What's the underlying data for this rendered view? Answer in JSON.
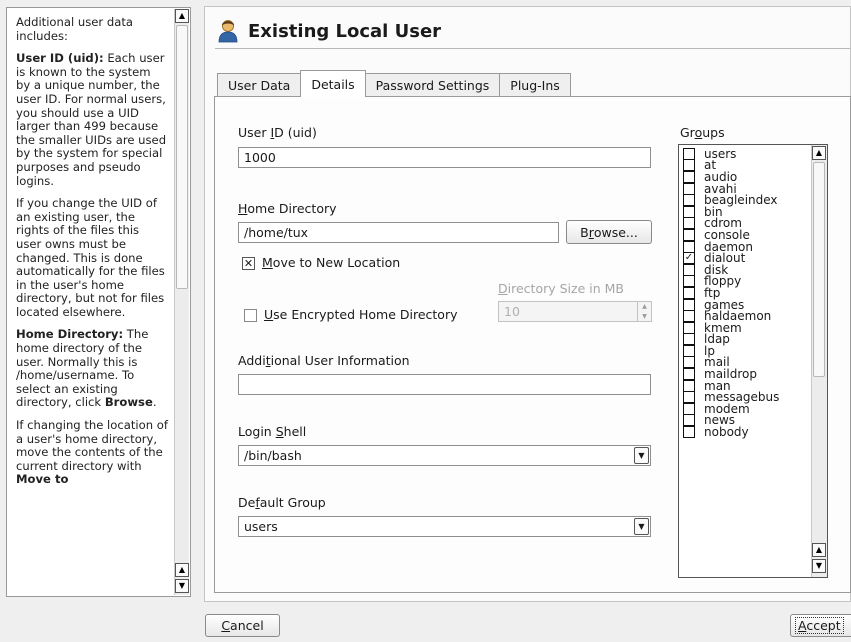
{
  "help": {
    "p1": "Additional user data includes:",
    "uid_head": "User ID (uid):",
    "uid_text": " Each user is known to the system by a unique number, the user ID. For normal users, you should use a UID larger than 499 because the smaller UIDs are used by the system for special purposes and pseudo logins.",
    "p3": "If you change the UID of an existing user, the rights of the files this user owns must be changed. This is done automatically for the files in the user's home directory, but not for files located elsewhere.",
    "home_head": "Home Directory:",
    "home_text_1": " The home directory of the user. Normally this is /home/username. To select an existing directory, click ",
    "home_bold_browse": "Browse",
    "home_text_2": ".",
    "p5_text": "If changing the location of a user's home directory, move the contents of the current directory with ",
    "p5_bold": "Move to"
  },
  "header": {
    "title": "Existing Local User",
    "icon": "user-icon"
  },
  "tabs": [
    "User Data",
    "Details",
    "Password Settings",
    "Plug-Ins"
  ],
  "active_tab": "Details",
  "form": {
    "uid_label_pre": "User ",
    "uid_label_u": "I",
    "uid_label_post": "D (uid)",
    "uid_value": "1000",
    "home_label_u": "H",
    "home_label_post": "ome Directory",
    "home_value": "/home/tux",
    "browse_pre": "B",
    "browse_u": "r",
    "browse_post": "owse...",
    "move_label_u": "M",
    "move_label_post": "ove to New Location",
    "move_checked": true,
    "dirsize_label_u": "D",
    "dirsize_label_post": "irectory Size in MB",
    "dirsize_value": "10",
    "encrypted_label_u": "U",
    "encrypted_label_post": "se Encrypted Home Directory",
    "encrypted_checked": false,
    "addinfo_label_pre": "Addi",
    "addinfo_label_u": "t",
    "addinfo_label_post": "ional User Information",
    "addinfo_value": "",
    "shell_label_pre": "Login ",
    "shell_label_u": "S",
    "shell_label_post": "hell",
    "shell_value": "/bin/bash",
    "group_label_pre": "De",
    "group_label_u": "f",
    "group_label_post": "ault Group",
    "group_value": "users"
  },
  "groups": {
    "label_pre": "Gr",
    "label_u": "o",
    "label_post": "ups",
    "items": [
      {
        "name": "users",
        "checked": false
      },
      {
        "name": "at",
        "checked": false
      },
      {
        "name": "audio",
        "checked": false
      },
      {
        "name": "avahi",
        "checked": false
      },
      {
        "name": "beagleindex",
        "checked": false
      },
      {
        "name": "bin",
        "checked": false
      },
      {
        "name": "cdrom",
        "checked": false
      },
      {
        "name": "console",
        "checked": false
      },
      {
        "name": "daemon",
        "checked": false
      },
      {
        "name": "dialout",
        "checked": true
      },
      {
        "name": "disk",
        "checked": false
      },
      {
        "name": "floppy",
        "checked": false
      },
      {
        "name": "ftp",
        "checked": false
      },
      {
        "name": "games",
        "checked": false
      },
      {
        "name": "haldaemon",
        "checked": false
      },
      {
        "name": "kmem",
        "checked": false
      },
      {
        "name": "ldap",
        "checked": false
      },
      {
        "name": "lp",
        "checked": false
      },
      {
        "name": "mail",
        "checked": false
      },
      {
        "name": "maildrop",
        "checked": false
      },
      {
        "name": "man",
        "checked": false
      },
      {
        "name": "messagebus",
        "checked": false
      },
      {
        "name": "modem",
        "checked": false
      },
      {
        "name": "news",
        "checked": false
      },
      {
        "name": "nobody",
        "checked": false
      }
    ]
  },
  "footer": {
    "cancel_u": "C",
    "cancel_post": "ancel",
    "accept_u": "A",
    "accept_post": "ccept"
  }
}
